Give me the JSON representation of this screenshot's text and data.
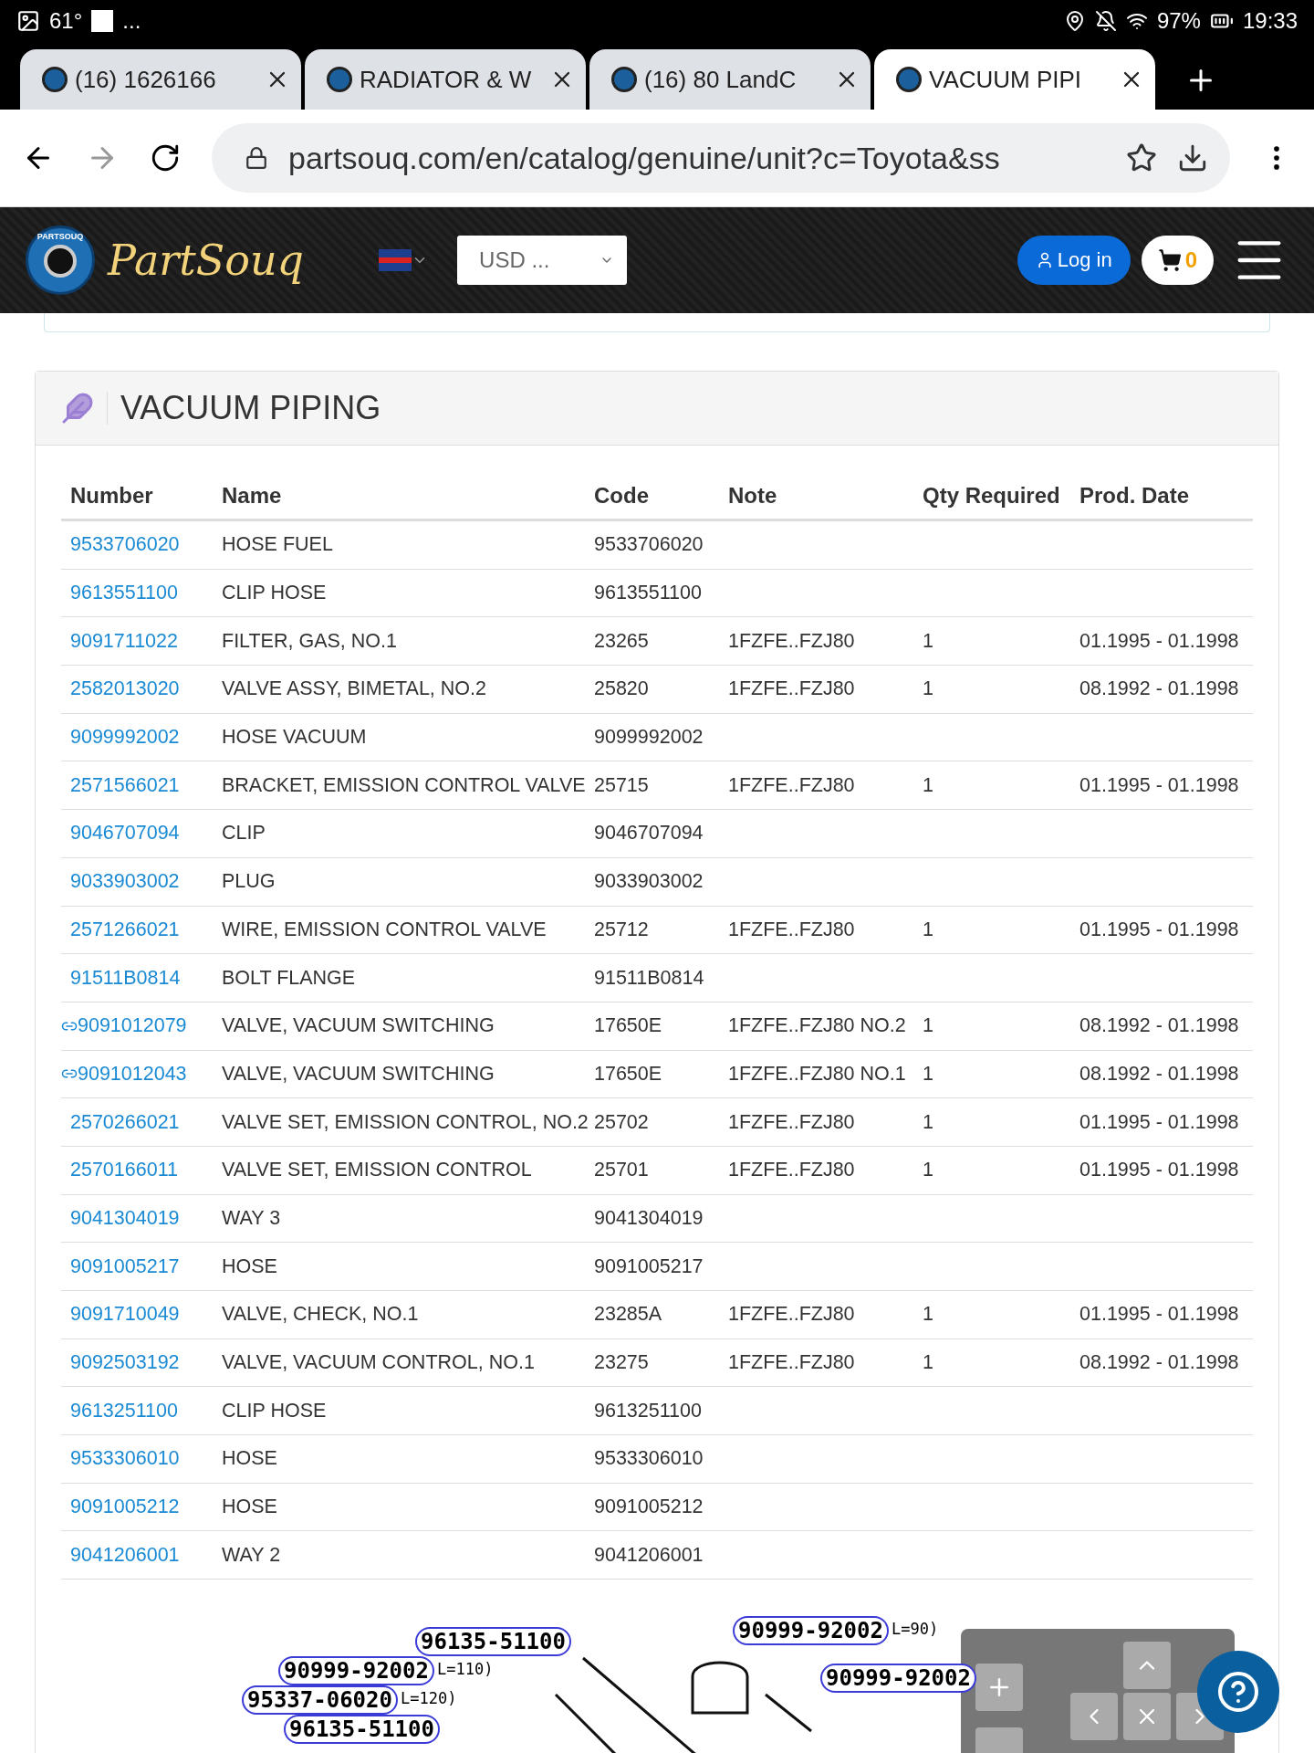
{
  "status_bar": {
    "temperature": "61°",
    "more": "...",
    "battery": "97%",
    "time": "19:33"
  },
  "browser_tabs": [
    {
      "title": "(16) 1626166",
      "selected": false
    },
    {
      "title": "RADIATOR & W",
      "selected": false
    },
    {
      "title": "(16) 80 LandC",
      "selected": false
    },
    {
      "title": "VACUUM PIPI",
      "selected": true
    }
  ],
  "address_bar": {
    "url": "partsouq.com/en/catalog/genuine/unit?c=Toyota&ss"
  },
  "site_header": {
    "logo_badge": "PARTSOUQ",
    "logo": "PartSouq",
    "currency": "USD ...",
    "login": "Log in",
    "cart_count": "0"
  },
  "section": {
    "title": "VACUUM PIPING"
  },
  "table": {
    "columns": [
      "Number",
      "Name",
      "Code",
      "Note",
      "Qty Required",
      "Prod. Date"
    ],
    "rows": [
      {
        "number": "9533706020",
        "name": "HOSE FUEL",
        "code": "9533706020",
        "linked": false
      },
      {
        "number": "9613551100",
        "name": "CLIP HOSE",
        "code": "9613551100",
        "linked": false
      },
      {
        "number": "9091711022",
        "name": "FILTER, GAS, NO.1",
        "code": "23265",
        "note": "1FZFE..FZJ80",
        "qty": "1",
        "date": "01.1995 - 01.1998",
        "linked": false
      },
      {
        "number": "2582013020",
        "name": "VALVE ASSY, BIMETAL, NO.2",
        "code": "25820",
        "note": "1FZFE..FZJ80",
        "qty": "1",
        "date": "08.1992 - 01.1998",
        "linked": false
      },
      {
        "number": "9099992002",
        "name": "HOSE VACUUM",
        "code": "9099992002",
        "linked": false
      },
      {
        "number": "2571566021",
        "name": "BRACKET, EMISSION CONTROL VALVE",
        "code": "25715",
        "note": "1FZFE..FZJ80",
        "qty": "1",
        "date": "01.1995 - 01.1998",
        "linked": false
      },
      {
        "number": "9046707094",
        "name": "CLIP",
        "code": "9046707094",
        "linked": false
      },
      {
        "number": "9033903002",
        "name": "PLUG",
        "code": "9033903002",
        "linked": false
      },
      {
        "number": "2571266021",
        "name": "WIRE, EMISSION CONTROL VALVE",
        "code": "25712",
        "note": "1FZFE..FZJ80",
        "qty": "1",
        "date": "01.1995 - 01.1998",
        "linked": false
      },
      {
        "number": "91511B0814",
        "name": "BOLT FLANGE",
        "code": "91511B0814",
        "linked": false
      },
      {
        "number": "9091012079",
        "name": "VALVE, VACUUM SWITCHING",
        "code": "17650E",
        "note": "1FZFE..FZJ80 NO.2",
        "qty": "1",
        "date": "08.1992 - 01.1998",
        "linked": true
      },
      {
        "number": "9091012043",
        "name": "VALVE, VACUUM SWITCHING",
        "code": "17650E",
        "note": "1FZFE..FZJ80 NO.1",
        "qty": "1",
        "date": "08.1992 - 01.1998",
        "linked": true
      },
      {
        "number": "2570266021",
        "name": "VALVE SET, EMISSION CONTROL, NO.2",
        "code": "25702",
        "note": "1FZFE..FZJ80",
        "qty": "1",
        "date": "01.1995 - 01.1998",
        "linked": false
      },
      {
        "number": "2570166011",
        "name": "VALVE SET, EMISSION CONTROL",
        "code": "25701",
        "note": "1FZFE..FZJ80",
        "qty": "1",
        "date": "01.1995 - 01.1998",
        "linked": false
      },
      {
        "number": "9041304019",
        "name": "WAY 3",
        "code": "9041304019",
        "linked": false
      },
      {
        "number": "9091005217",
        "name": "HOSE",
        "code": "9091005217",
        "linked": false
      },
      {
        "number": "9091710049",
        "name": "VALVE, CHECK, NO.1",
        "code": "23285A",
        "note": "1FZFE..FZJ80",
        "qty": "1",
        "date": "01.1995 - 01.1998",
        "linked": false
      },
      {
        "number": "9092503192",
        "name": "VALVE, VACUUM CONTROL, NO.1",
        "code": "23275",
        "note": "1FZFE..FZJ80",
        "qty": "1",
        "date": "08.1992 - 01.1998",
        "linked": false
      },
      {
        "number": "9613251100",
        "name": "CLIP HOSE",
        "code": "9613251100",
        "linked": false
      },
      {
        "number": "9533306010",
        "name": "HOSE",
        "code": "9533306010",
        "linked": false
      },
      {
        "number": "9091005212",
        "name": "HOSE",
        "code": "9091005212",
        "linked": false
      },
      {
        "number": "9041206001",
        "name": "WAY 2",
        "code": "9041206001",
        "linked": false
      }
    ]
  },
  "diagram": {
    "callouts": [
      {
        "part": "96135-51100"
      },
      {
        "part": "90999-92002",
        "suffix": "L=110)"
      },
      {
        "part": "95337-06020",
        "suffix": "L=120)"
      },
      {
        "part": "96135-51100"
      },
      {
        "part": "90999-92002",
        "suffix": "L=90)"
      },
      {
        "part": "90999-92002"
      }
    ]
  }
}
